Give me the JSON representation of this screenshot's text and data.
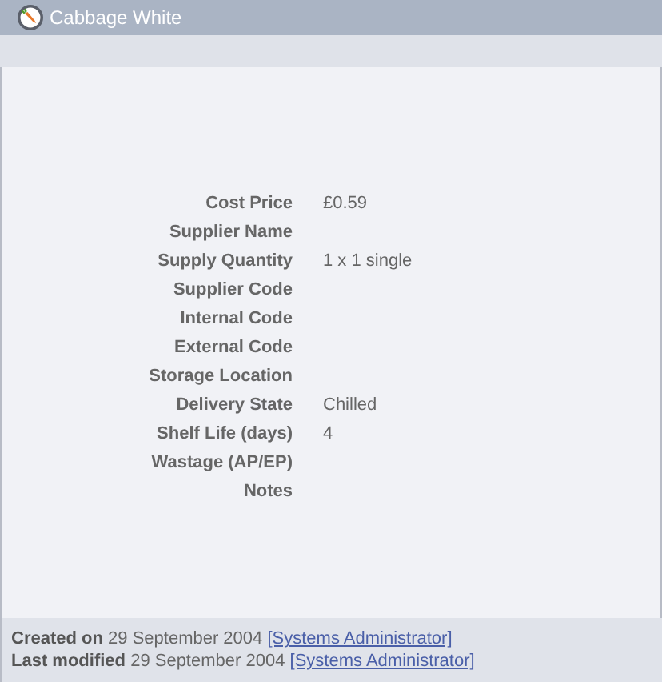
{
  "window": {
    "title": "Cabbage White"
  },
  "fields": [
    {
      "label": "Cost Price",
      "value": "£0.59"
    },
    {
      "label": "Supplier Name"
    },
    {
      "label": "Supply Quantity",
      "value": "1 x 1 single"
    },
    {
      "label": "Supplier Code"
    },
    {
      "label": "Internal Code"
    },
    {
      "label": "External Code"
    },
    {
      "label": "Storage Location"
    },
    {
      "label": "Delivery State",
      "value": "Chilled"
    },
    {
      "label": "Shelf Life (days)",
      "value": "4"
    },
    {
      "label": "Wastage (AP/EP)"
    },
    {
      "label": "Notes"
    }
  ],
  "footer": [
    {
      "text": "**Created on** 29 September 2004",
      "link": "[Systems Administrator]"
    },
    {
      "text": "**Last modified** 29 September 2004",
      "link": "[Systems Administrator]"
    }
  ]
}
